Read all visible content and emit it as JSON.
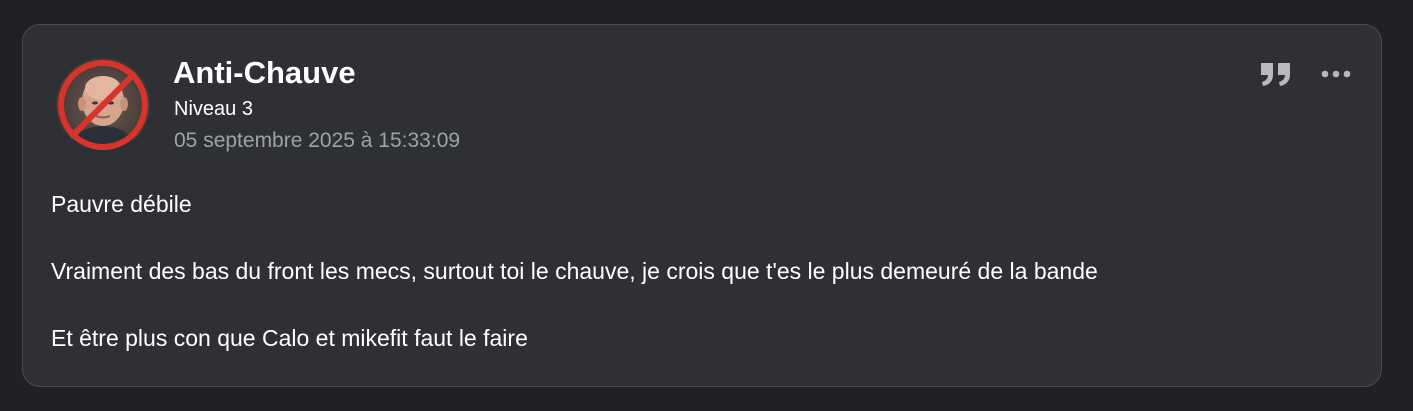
{
  "post": {
    "author": {
      "name": "Anti-Chauve",
      "level": "Niveau 3",
      "avatar": "avatar-icon"
    },
    "date": "05 septembre 2025 à 15:33:09",
    "actions": {
      "quote_icon": "quote-icon",
      "more_icon": "more-options-icon"
    },
    "paragraphs": [
      "Pauvre débile",
      "Vraiment des bas du front les mecs, surtout toi le chauve, je crois que t'es le plus demeuré de la bande",
      "Et être plus con que Calo et mikefit faut le faire"
    ]
  },
  "colors": {
    "page_background": "#202124",
    "card_background": "#2e3035",
    "card_border": "#4a4c51",
    "text": "#ffffff",
    "muted_text": "#9ea1a6",
    "icon": "#b7b9bd",
    "avatar_ring": "#d8342b"
  }
}
